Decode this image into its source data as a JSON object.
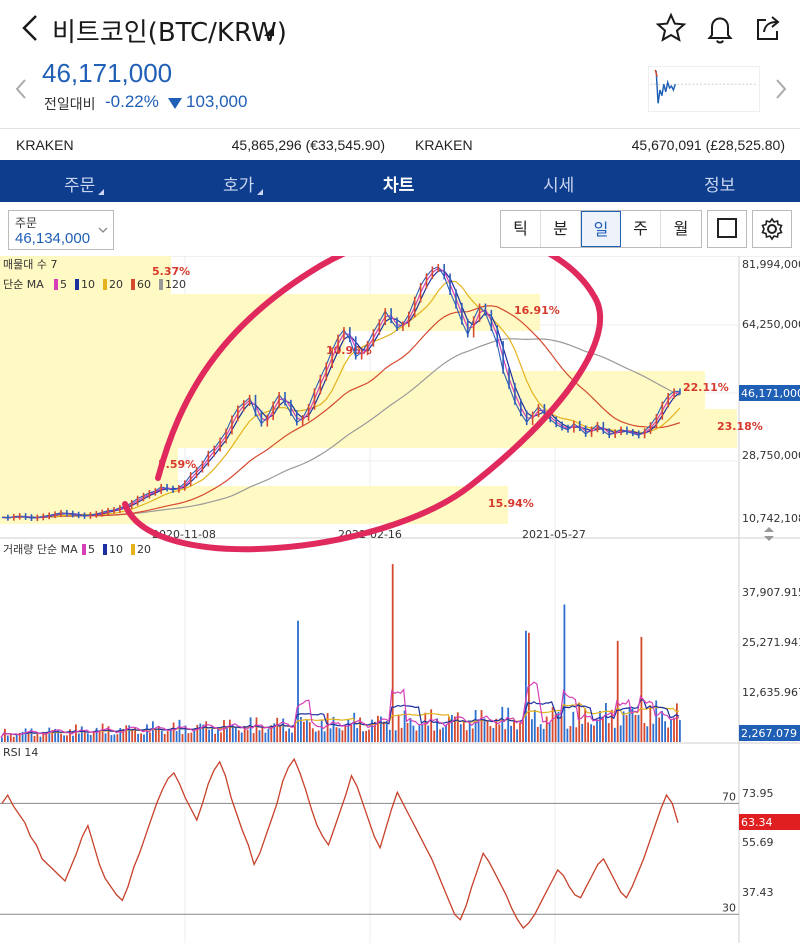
{
  "header": {
    "title": "비트코인(BTC/KRW)",
    "back_icon": "chevron-left-icon",
    "icons": [
      "star-icon",
      "bell-icon",
      "share-icon"
    ]
  },
  "price": {
    "current": "46,171,000",
    "diff_label": "전일대비",
    "diff_pct": "-0.22%",
    "diff_amt": "103,000",
    "color_down": "#1f5fb6"
  },
  "exchanges": [
    {
      "name": "KRAKEN",
      "value": "45,865,296 (€33,545.90)"
    },
    {
      "name": "KRAKEN",
      "value": "45,670,091 (£28,525.80)"
    }
  ],
  "tabs": [
    {
      "label": "주문",
      "active": false,
      "dropdown": true
    },
    {
      "label": "호가",
      "active": false,
      "dropdown": true
    },
    {
      "label": "차트",
      "active": true,
      "dropdown": false
    },
    {
      "label": "시세",
      "active": false,
      "dropdown": false
    },
    {
      "label": "정보",
      "active": false,
      "dropdown": false
    }
  ],
  "controls": {
    "order_label": "주문",
    "order_value": "46,134,000",
    "periods": [
      {
        "label": "틱",
        "active": false
      },
      {
        "label": "분",
        "active": false
      },
      {
        "label": "일",
        "active": true
      },
      {
        "label": "주",
        "active": false
      },
      {
        "label": "월",
        "active": false
      }
    ]
  },
  "price_chart": {
    "legend_top": "매물대 수 7",
    "legend_ma": "단순 MA",
    "ma_periods": [
      "5",
      "10",
      "20",
      "60",
      "120"
    ],
    "ma_colors": [
      "#d63fb8",
      "#1b2f9e",
      "#e3b21c",
      "#d6492f",
      "#9a9a9a"
    ],
    "y_labels": [
      "81,994,000",
      "64,250,000",
      "46,171,000",
      "28,750,000",
      "10,742,108"
    ],
    "x_labels": [
      "2020-11-08",
      "2021-02-16",
      "2021-05-27"
    ],
    "current_tag": "46,171,000",
    "volume_profile": [
      "5.37%",
      "16.91%",
      "10.90%",
      "22.11%",
      "23.18%",
      "5.59%",
      "15.94%"
    ]
  },
  "volume_chart": {
    "legend": "거래량 단순 MA",
    "ma_periods": [
      "5",
      "10",
      "20"
    ],
    "y_labels": [
      "37,907.915",
      "25,271.941",
      "12,635.967"
    ],
    "current_tag": "2,267.079"
  },
  "rsi_chart": {
    "legend": "RSI 14",
    "y_labels": [
      "73.95",
      "55.69",
      "37.43"
    ],
    "level_high": "70",
    "level_low": "30",
    "current_tag": "63.34"
  },
  "chart_data": {
    "type": "line",
    "x_dates": [
      "2020-11-08",
      "2021-02-16",
      "2021-05-27"
    ],
    "price_ylim": [
      10742108,
      81994000
    ],
    "price_series": [
      10.9,
      10.8,
      11.1,
      11.3,
      11.0,
      10.7,
      10.9,
      11.2,
      11.5,
      11.8,
      12.2,
      12.0,
      11.7,
      11.5,
      11.3,
      11.6,
      11.9,
      12.3,
      12.8,
      13.0,
      13.6,
      14.1,
      15.0,
      16.2,
      17.0,
      17.8,
      18.3,
      19.5,
      19.0,
      18.6,
      19.2,
      20.5,
      22.8,
      24.3,
      26.0,
      28.8,
      30.2,
      32.5,
      35.0,
      38.7,
      41.5,
      43.0,
      44.5,
      40.1,
      37.2,
      39.0,
      42.6,
      45.3,
      43.1,
      40.2,
      37.5,
      38.8,
      41.9,
      46.3,
      50.1,
      53.6,
      57.8,
      61.4,
      63.5,
      60.9,
      56.0,
      57.2,
      59.6,
      62.9,
      65.7,
      68.8,
      66.2,
      64.0,
      65.1,
      67.8,
      72.0,
      75.9,
      78.6,
      80.5,
      81.2,
      78.5,
      74.1,
      70.3,
      65.8,
      62.2,
      66.5,
      70.1,
      68.3,
      64.0,
      59.6,
      52.0,
      47.8,
      43.3,
      40.1,
      37.6,
      39.8,
      41.9,
      40.0,
      38.4,
      37.0,
      36.1,
      35.5,
      37.2,
      35.9,
      34.3,
      35.6,
      36.9,
      35.1,
      34.0,
      34.8,
      35.6,
      34.9,
      34.5,
      33.9,
      35.1,
      36.8,
      39.1,
      42.6,
      45.0,
      46.3,
      46.2
    ],
    "rsi_ylim": [
      20,
      90
    ],
    "rsi_levels": [
      70,
      30
    ],
    "rsi_series": [
      70,
      73,
      69,
      66,
      63,
      58,
      55,
      50,
      48,
      46,
      44,
      42,
      47,
      52,
      58,
      62,
      55,
      48,
      43,
      40,
      37,
      35,
      40,
      47,
      52,
      58,
      64,
      70,
      75,
      79,
      81,
      77,
      72,
      68,
      64,
      70,
      77,
      82,
      85,
      80,
      72,
      66,
      60,
      55,
      48,
      52,
      58,
      64,
      70,
      78,
      83,
      86,
      81,
      75,
      68,
      62,
      58,
      55,
      61,
      67,
      73,
      80,
      76,
      70,
      64,
      58,
      54,
      61,
      68,
      74,
      70,
      66,
      62,
      58,
      54,
      50,
      45,
      40,
      35,
      30,
      28,
      33,
      40,
      46,
      52,
      49,
      45,
      41,
      37,
      32,
      28,
      25,
      27,
      30,
      34,
      38,
      42,
      46,
      44,
      40,
      37,
      36,
      40,
      44,
      48,
      50,
      46,
      42,
      38,
      36,
      40,
      45,
      50,
      56,
      62,
      68,
      73,
      70,
      63
    ]
  }
}
